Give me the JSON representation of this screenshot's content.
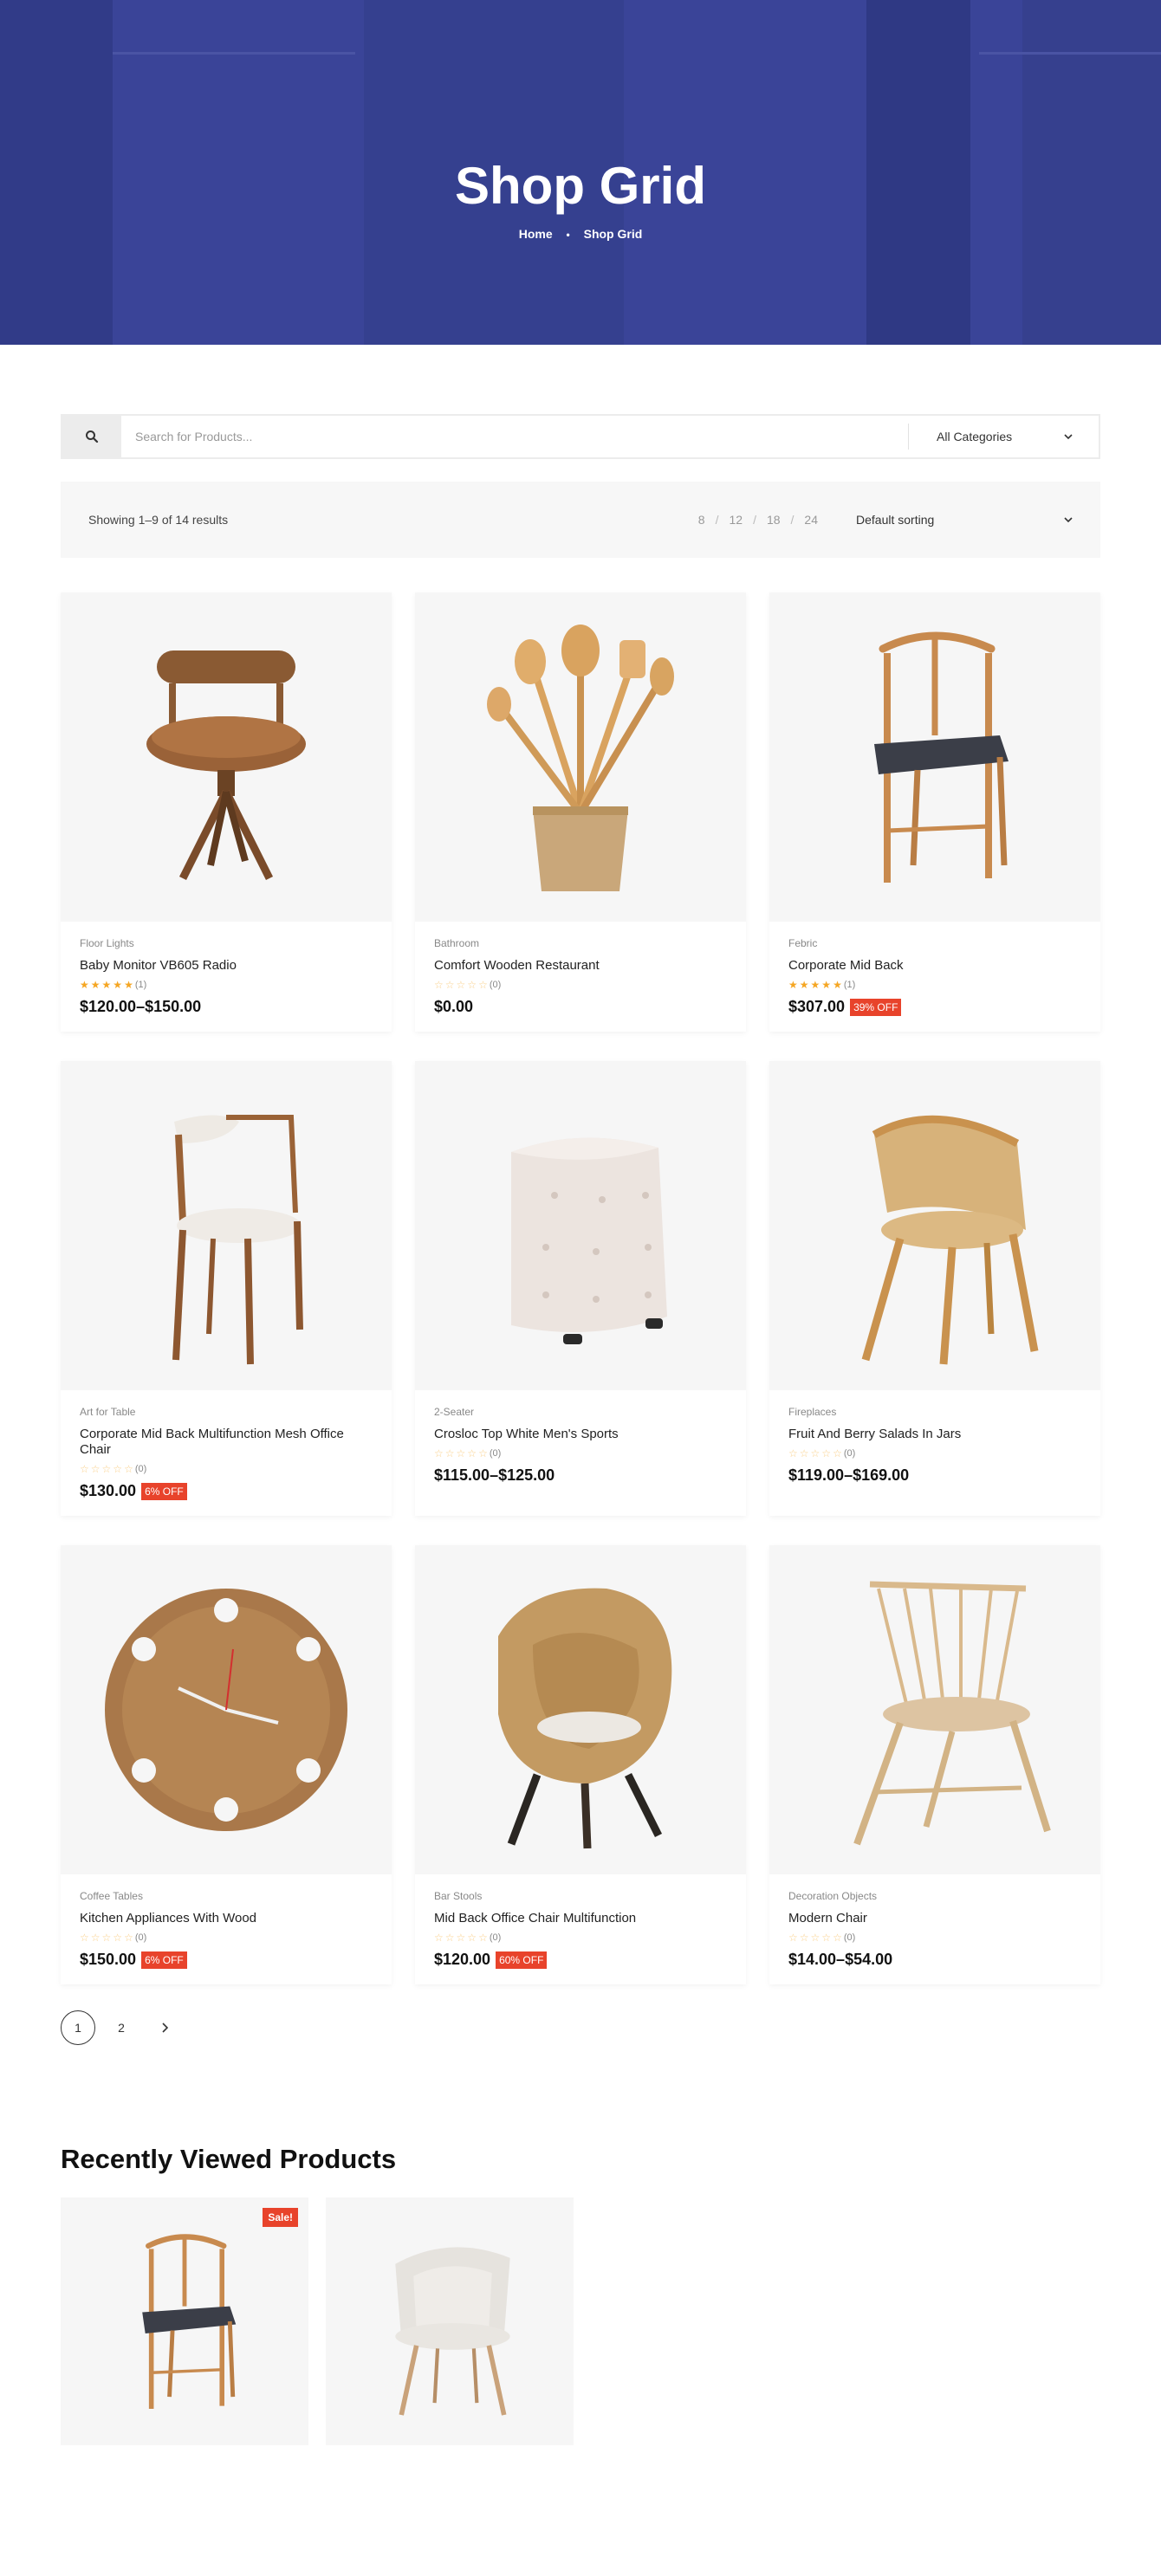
{
  "hero": {
    "title": "Shop Grid",
    "breadcrumb": {
      "home": "Home",
      "separator": "•",
      "current": "Shop Grid"
    }
  },
  "search": {
    "placeholder": "Search for Products...",
    "category": "All Categories"
  },
  "toolbar": {
    "result_count": "Showing 1–9 of 14 results",
    "per_page": [
      "8",
      "12",
      "18",
      "24"
    ],
    "separator": "/",
    "sorting": "Default sorting"
  },
  "products": [
    {
      "category": "Floor Lights",
      "name": "Baby Monitor VB605 Radio",
      "rating": 5,
      "reviews": "(1)",
      "price": "$120.00–$150.00",
      "badge": "",
      "image": "swivel-leather-chair"
    },
    {
      "category": "Bathroom",
      "name": "Comfort Wooden Restaurant",
      "rating": 0,
      "reviews": "(0)",
      "price": "$0.00",
      "badge": "",
      "image": "wooden-utensils"
    },
    {
      "category": "Febric",
      "name": "Corporate Mid Back",
      "rating": 5,
      "reviews": "(1)",
      "price": "$307.00",
      "badge": "39% OFF",
      "image": "wishbone-chair"
    },
    {
      "category": "Art for Table",
      "name": "Corporate Mid Back Multifunction Mesh Office Chair",
      "rating": 0,
      "reviews": "(0)",
      "price": "$130.00",
      "badge": "6% OFF",
      "image": "modern-armchair"
    },
    {
      "category": "2-Seater",
      "name": "Crosloc Top White Men's Sports",
      "rating": 0,
      "reviews": "(0)",
      "price": "$115.00–$125.00",
      "badge": "",
      "image": "tufted-pouf"
    },
    {
      "category": "Fireplaces",
      "name": "Fruit And Berry Salads In Jars",
      "rating": 0,
      "reviews": "(0)",
      "price": "$119.00–$169.00",
      "badge": "",
      "image": "rattan-chair"
    },
    {
      "category": "Coffee Tables",
      "name": "Kitchen Appliances With Wood",
      "rating": 0,
      "reviews": "(0)",
      "price": "$150.00",
      "badge": "6% OFF",
      "image": "wooden-wall-clock"
    },
    {
      "category": "Bar Stools",
      "name": "Mid Back Office Chair Multifunction",
      "rating": 0,
      "reviews": "(0)",
      "price": "$120.00",
      "badge": "60% OFF",
      "image": "wicker-egg-chair"
    },
    {
      "category": "Decoration Objects",
      "name": "Modern Chair",
      "rating": 0,
      "reviews": "(0)",
      "price": "$14.00–$54.00",
      "badge": "",
      "image": "spindle-chair"
    }
  ],
  "pagination": {
    "pages": [
      "1",
      "2"
    ],
    "current": "1"
  },
  "recent": {
    "title": "Recently Viewed Products",
    "items": [
      {
        "image": "wishbone-chair",
        "badge": "Sale!"
      },
      {
        "image": "upholstered-chair",
        "badge": ""
      }
    ]
  },
  "colors": {
    "hero_overlay": "#3a4498",
    "sale_badge": "#e8432b",
    "star": "#f5a623"
  }
}
